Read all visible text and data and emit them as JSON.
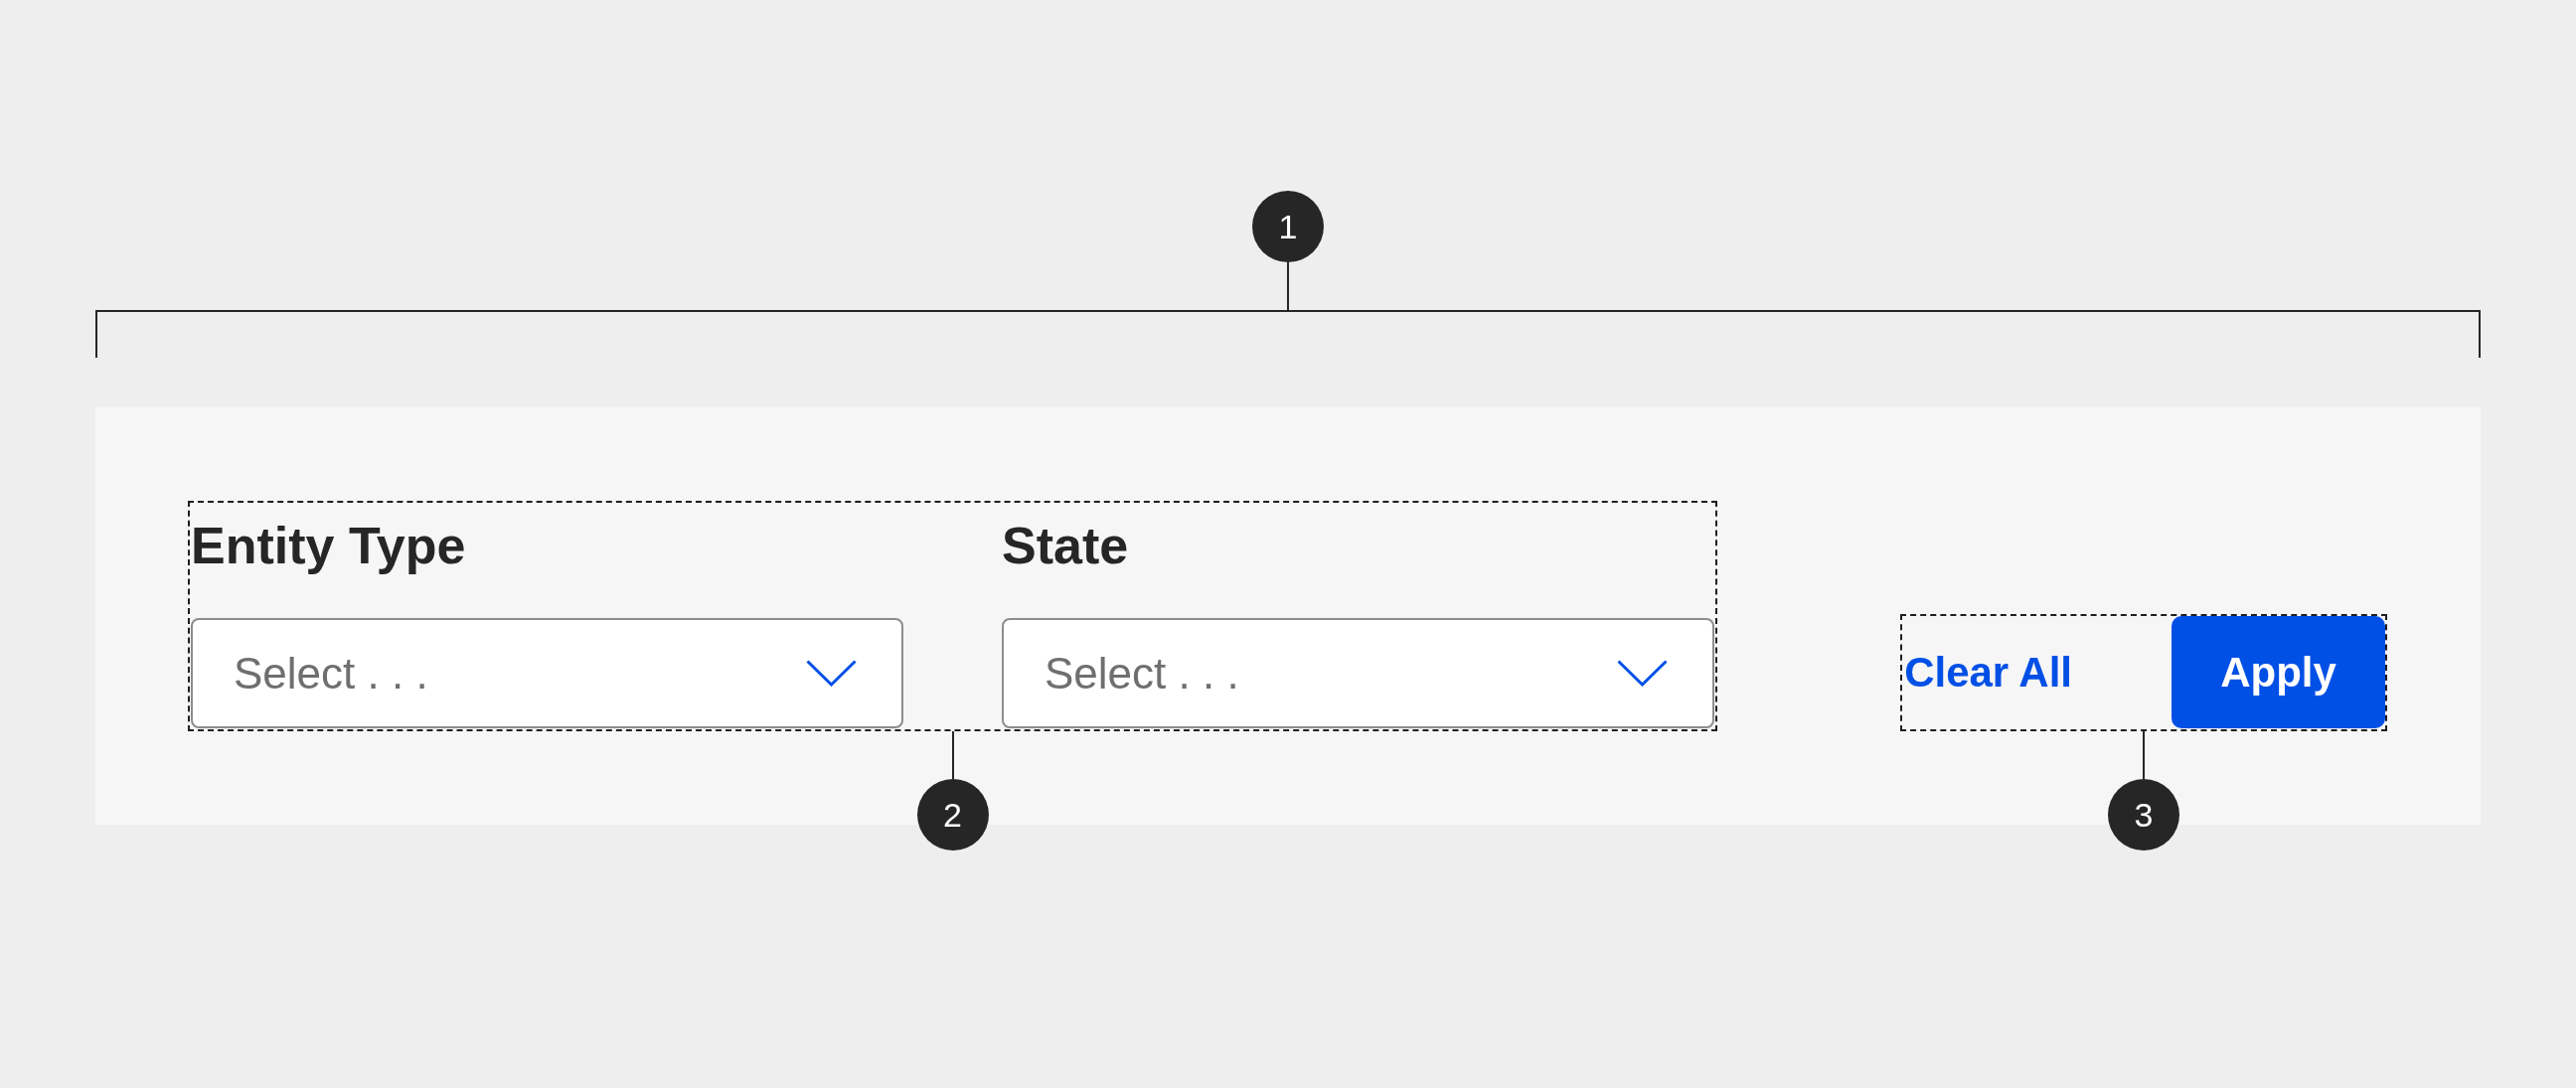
{
  "overall_callout": {
    "number": "1"
  },
  "filter_panel": {
    "field_group": {
      "callout_number": "2",
      "fields": [
        {
          "label": "Entity Type",
          "placeholder": "Select . . ."
        },
        {
          "label": "State",
          "placeholder": "Select . . ."
        }
      ]
    },
    "action_group": {
      "callout_number": "3",
      "clear_link": "Clear All",
      "apply_button": "Apply"
    }
  }
}
